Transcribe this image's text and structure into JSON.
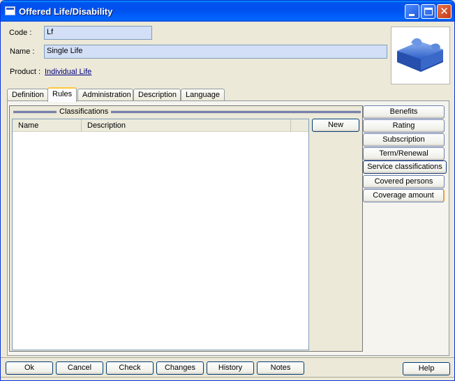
{
  "window": {
    "title": "Offered Life/Disability"
  },
  "form": {
    "code_label": "Code :",
    "code_value": "Lf",
    "name_label": "Name :",
    "name_value": "Single Life",
    "product_label": "Product :",
    "product_link": "Individual Life"
  },
  "tabs": [
    {
      "label": "Definition",
      "active": false
    },
    {
      "label": "Rules",
      "active": true
    },
    {
      "label": "Administration",
      "active": false
    },
    {
      "label": "Description",
      "active": false
    },
    {
      "label": "Language",
      "active": false
    }
  ],
  "classifications": {
    "group_title": "Classifications",
    "columns": [
      "Name",
      "Description"
    ],
    "rows": [],
    "new_button": "New"
  },
  "side_buttons": [
    "Benefits",
    "Rating",
    "Subscription",
    "Term/Renewal",
    "Service classifications",
    "Covered persons",
    "Coverage amount"
  ],
  "bottom_buttons": [
    "Ok",
    "Cancel",
    "Check",
    "Changes",
    "History",
    "Notes"
  ],
  "help_button": "Help",
  "colors": {
    "titlebar": "#0054e3",
    "field_bg": "#d3dff7",
    "window_bg": "#ece9d8",
    "link": "#00007f"
  },
  "icons": {
    "window": "form-icon",
    "logo": "puzzle-logo"
  }
}
